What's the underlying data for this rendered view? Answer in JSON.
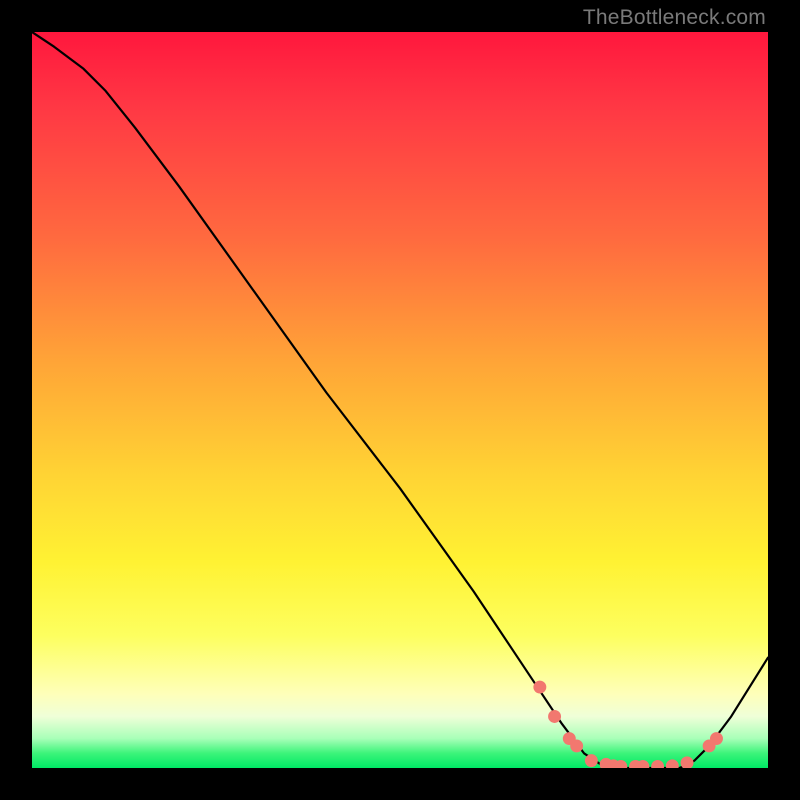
{
  "watermark": "TheBottleneck.com",
  "colors": {
    "frame_bg": "#000000",
    "dot": "#f2786f",
    "line": "#000000"
  },
  "chart_data": {
    "type": "line",
    "title": "",
    "xlabel": "",
    "ylabel": "",
    "xlim": [
      0,
      100
    ],
    "ylim": [
      0,
      100
    ],
    "series": [
      {
        "name": "curve",
        "x": [
          0,
          3,
          7,
          10,
          14,
          20,
          30,
          40,
          50,
          60,
          68,
          72,
          75,
          78,
          80,
          84,
          88,
          90,
          92,
          95,
          100
        ],
        "y": [
          100,
          98,
          95,
          92,
          87,
          79,
          65,
          51,
          38,
          24,
          12,
          6,
          2,
          0,
          0,
          0,
          0,
          1,
          3,
          7,
          15
        ]
      }
    ],
    "markers": {
      "name": "highlight-dots",
      "x": [
        69,
        71,
        73,
        74,
        76,
        78,
        79,
        80,
        82,
        83,
        85,
        87,
        89,
        92,
        93
      ],
      "y": [
        11,
        7,
        4,
        3,
        1,
        0.5,
        0.3,
        0.2,
        0.2,
        0.2,
        0.2,
        0.3,
        0.7,
        3,
        4
      ]
    }
  }
}
